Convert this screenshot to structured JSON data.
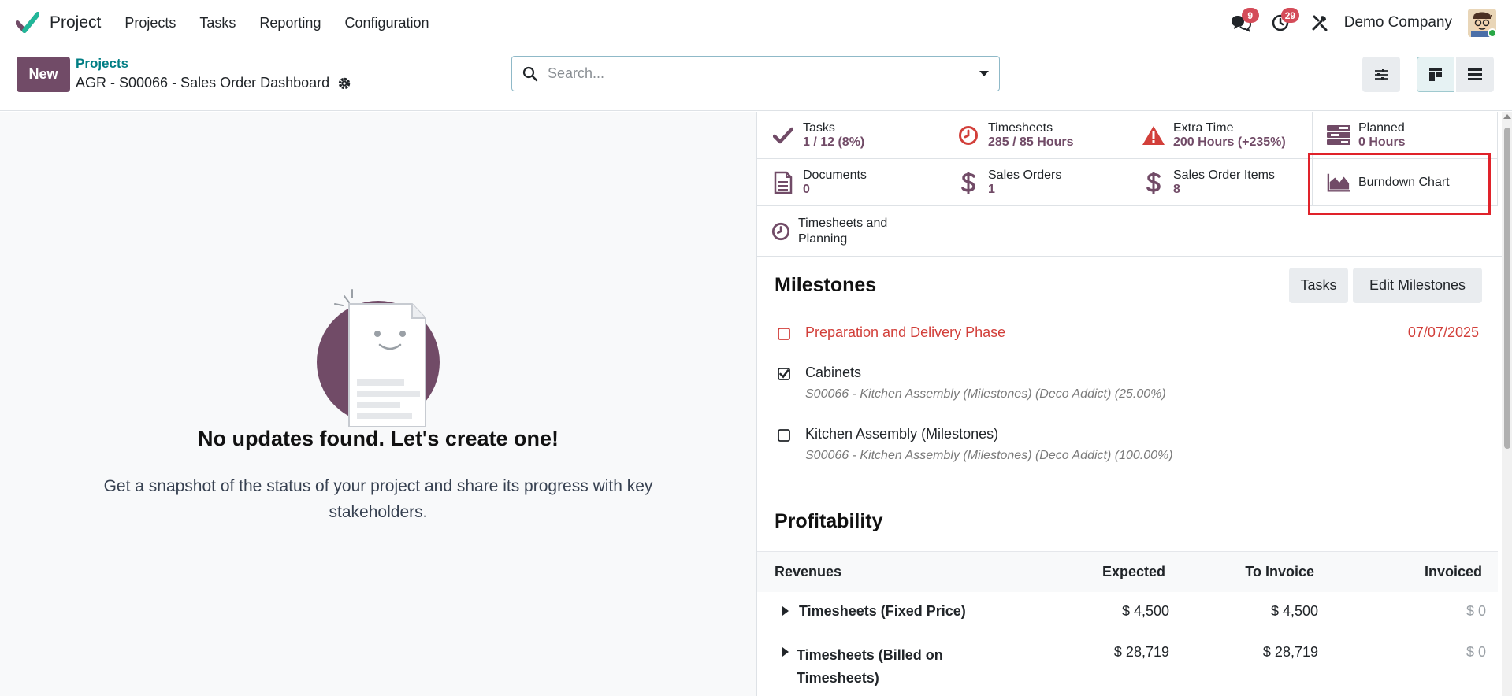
{
  "navbar": {
    "brand": "Project",
    "menu": [
      "Projects",
      "Tasks",
      "Reporting",
      "Configuration"
    ],
    "messages_count": "9",
    "activities_count": "29",
    "company": "Demo Company"
  },
  "control": {
    "new_label": "New",
    "breadcrumb_parent": "Projects",
    "breadcrumb_current": "AGR - S00066 - Sales Order Dashboard",
    "search_placeholder": "Search..."
  },
  "helper": {
    "title": "No updates found. Let's create one!",
    "text": "Get a snapshot of the status of your project and share its progress with key stakeholders."
  },
  "stats": [
    {
      "label": "Tasks",
      "value": "1 / 12 (8%)",
      "icon": "check-icon"
    },
    {
      "label": "Timesheets",
      "value": "285 / 85 Hours",
      "icon": "clock-icon"
    },
    {
      "label": "Extra Time",
      "value": "200 Hours (+235%)",
      "icon": "warning-icon"
    },
    {
      "label": "Planned",
      "value": "0 Hours",
      "icon": "tasks-icon"
    },
    {
      "label": "Documents",
      "value": "0",
      "icon": "document-icon"
    },
    {
      "label": "Sales Orders",
      "value": "1",
      "icon": "dollar-icon"
    },
    {
      "label": "Sales Order Items",
      "value": "8",
      "icon": "dollar-icon"
    },
    {
      "label": "Burndown Chart",
      "value": "",
      "icon": "area-chart-icon"
    },
    {
      "label": "Timesheets and Planning",
      "value": "",
      "icon": "clock-icon"
    }
  ],
  "milestones": {
    "title": "Milestones",
    "tasks_button": "Tasks",
    "edit_button": "Edit Milestones",
    "items": [
      {
        "name": "Preparation and Delivery Phase",
        "date": "07/07/2025",
        "done": false,
        "late": true,
        "sub": ""
      },
      {
        "name": "Cabinets",
        "date": "",
        "done": true,
        "late": false,
        "sub": "S00066 - Kitchen Assembly (Milestones) (Deco Addict) (25.00%)"
      },
      {
        "name": "Kitchen Assembly (Milestones)",
        "date": "",
        "done": false,
        "late": false,
        "sub": "S00066 - Kitchen Assembly (Milestones) (Deco Addict) (100.00%)"
      }
    ]
  },
  "profitability": {
    "title": "Profitability",
    "headers": [
      "Revenues",
      "Expected",
      "To Invoice",
      "Invoiced"
    ],
    "rows": [
      {
        "name": "Timesheets (Fixed Price)",
        "expected": "$ 4,500",
        "to_invoice": "$ 4,500",
        "invoiced": "$ 0"
      },
      {
        "name": "Timesheets (Billed on Timesheets)",
        "expected": "$ 28,719",
        "to_invoice": "$ 28,719",
        "invoiced": "$ 0"
      }
    ]
  },
  "colors": {
    "brand": "#714b67",
    "link": "#017e84",
    "danger": "#d23f3a",
    "highlight": "#e0222a"
  }
}
